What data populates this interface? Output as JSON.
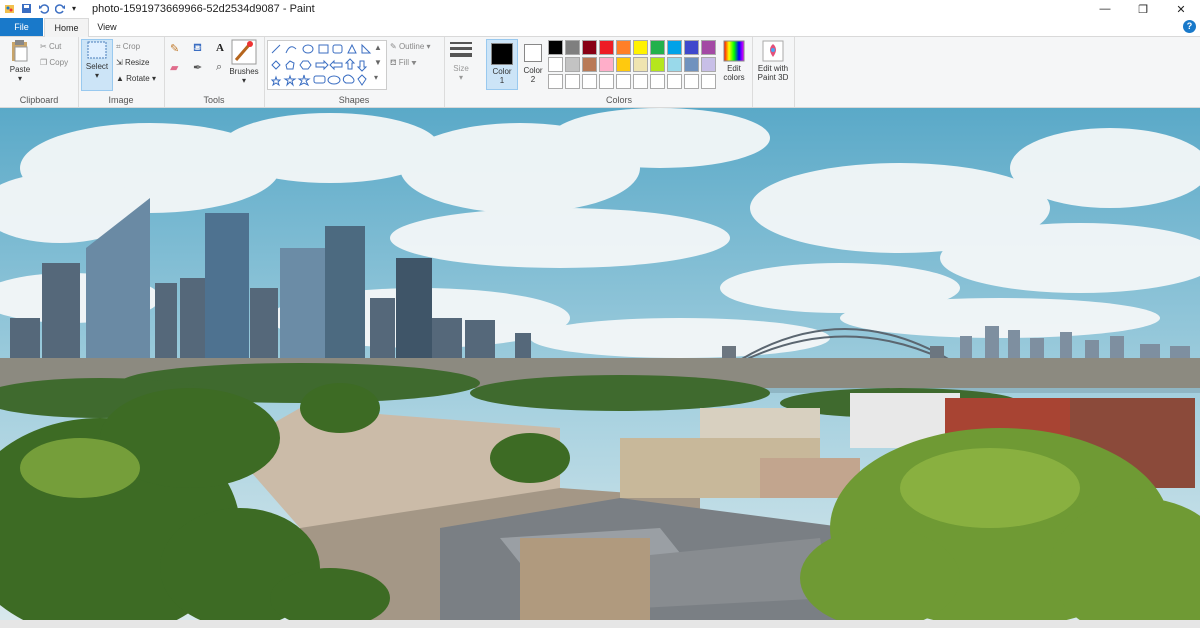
{
  "window": {
    "title": "photo-1591973669966-52d2534d9087 - Paint"
  },
  "tabs": {
    "file": "File",
    "home": "Home",
    "view": "View"
  },
  "help": "?",
  "clipboard": {
    "paste": "Paste",
    "cut": "Cut",
    "copy": "Copy",
    "group": "Clipboard"
  },
  "image": {
    "select": "Select",
    "crop": "Crop",
    "resize": "Resize",
    "rotate": "Rotate",
    "group": "Image"
  },
  "tools": {
    "group": "Tools",
    "brushes": "Brushes"
  },
  "shapes": {
    "outline": "Outline",
    "fill": "Fill",
    "group": "Shapes"
  },
  "size": {
    "label": "Size"
  },
  "colors": {
    "color1": "Color",
    "color1_num": "1",
    "color2": "Color",
    "color2_num": "2",
    "edit": "Edit",
    "edit2": "colors",
    "paint3d": "Edit with",
    "paint3d2": "Paint 3D",
    "group": "Colors",
    "palette": [
      "#000000",
      "#7f7f7f",
      "#880015",
      "#ed1c24",
      "#ff7f27",
      "#fff200",
      "#22b14c",
      "#00a2e8",
      "#3f48cc",
      "#a349a4",
      "#ffffff",
      "#c3c3c3",
      "#b97a57",
      "#ffaec9",
      "#ffc90e",
      "#efe4b0",
      "#b5e61d",
      "#99d9ea",
      "#7092be",
      "#c8bfe7",
      "#ffffff",
      "#ffffff",
      "#ffffff",
      "#ffffff",
      "#ffffff",
      "#ffffff",
      "#ffffff",
      "#ffffff",
      "#ffffff",
      "#ffffff"
    ]
  }
}
